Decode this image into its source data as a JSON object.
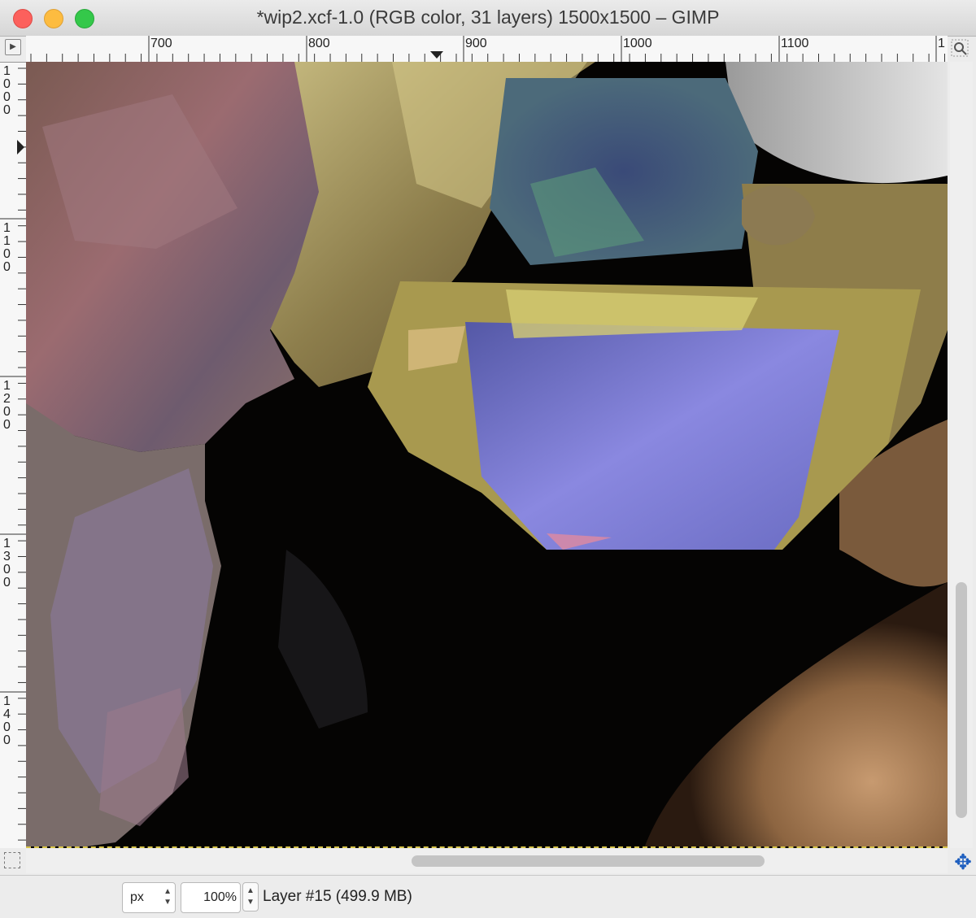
{
  "window": {
    "title": "*wip2.xcf-1.0 (RGB color, 31 layers) 1500x1500 – GIMP"
  },
  "rulers": {
    "horizontal_labels": [
      "700",
      "800",
      "900",
      "1000",
      "1100",
      "1"
    ],
    "vertical_labels": [
      "1000",
      "1100",
      "1200",
      "1300",
      "1400"
    ]
  },
  "icons": {
    "nav_menu": "navigation-menu-icon",
    "zoom": "zoom-magnifier-icon",
    "quick_mask": "quick-mask-icon",
    "navigate": "navigate-move-icon"
  },
  "status": {
    "unit": "px",
    "zoom": "100%",
    "layer_info": "Layer #15 (499.9 MB)"
  },
  "colors": {
    "close": "#fc605c",
    "minimize": "#fdbc40",
    "maximize": "#34c84a"
  }
}
